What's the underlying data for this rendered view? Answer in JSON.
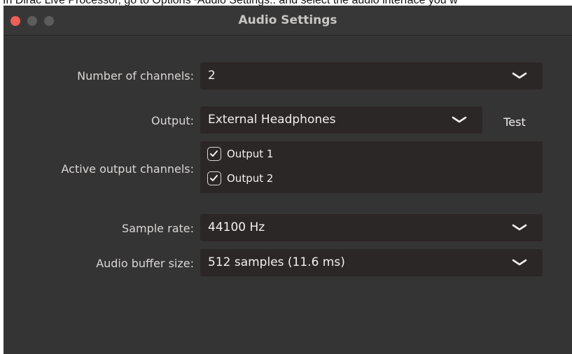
{
  "caption": "In Dirac Live Processor, go to Options~Audio Settings.. and select the audio interface you w",
  "window": {
    "title": "Audio Settings"
  },
  "settings": {
    "channels": {
      "label": "Number of channels:",
      "value": "2"
    },
    "output": {
      "label": "Output:",
      "value": "External Headphones",
      "test_label": "Test"
    },
    "active_channels": {
      "label": "Active output channels:",
      "items": [
        {
          "label": "Output 1",
          "checked": true
        },
        {
          "label": "Output 2",
          "checked": true
        }
      ]
    },
    "sample_rate": {
      "label": "Sample rate:",
      "value": "44100 Hz"
    },
    "buffer_size": {
      "label": "Audio buffer size:",
      "value": "512 samples (11.6 ms)"
    }
  },
  "colors": {
    "window_bg": "#353434",
    "field_bg": "#2b2726",
    "close_button": "#ee5f58",
    "inactive_button": "#5d5c5c",
    "text": "#f2f0ef"
  },
  "icons": {
    "dropdown": "chevron-down-icon",
    "checkbox": "checkmark-icon"
  }
}
